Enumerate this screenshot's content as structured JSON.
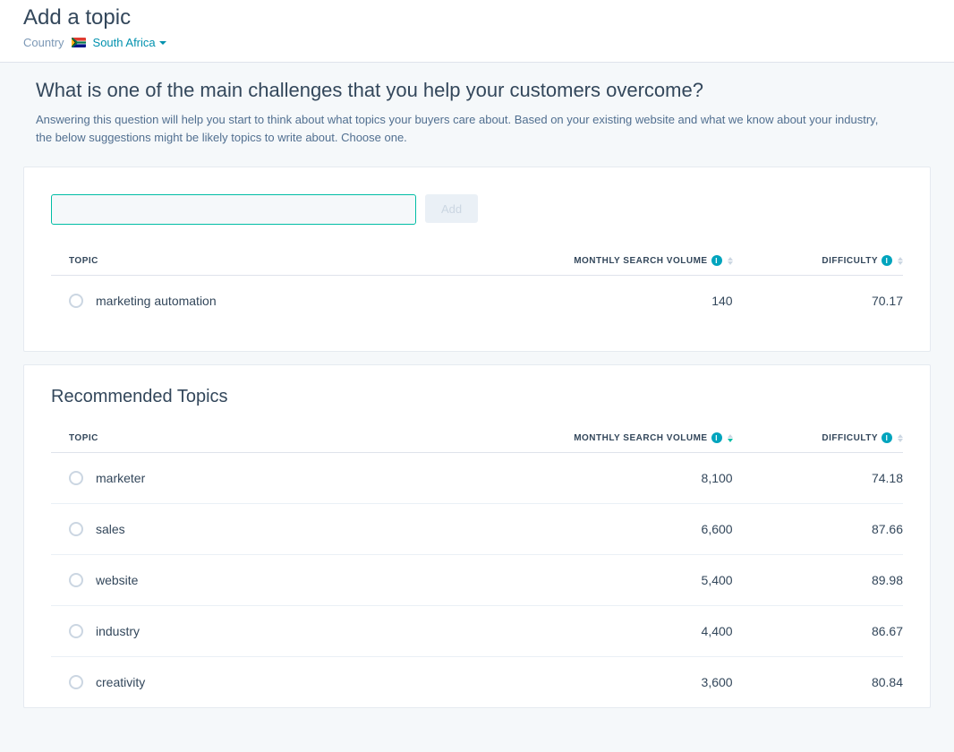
{
  "header": {
    "title": "Add a topic",
    "country_label": "Country",
    "country_value": "South Africa"
  },
  "intro": {
    "heading": "What is one of the main challenges that you help your customers overcome?",
    "text": "Answering this question will help you start to think about what topics your buyers care about. Based on your existing website and what we know about your industry, the below suggestions might be likely topics to write about. Choose one."
  },
  "add_card": {
    "add_label": "Add",
    "input_value": "",
    "columns": {
      "topic": "TOPIC",
      "volume": "MONTHLY SEARCH VOLUME",
      "difficulty": "DIFFICULTY"
    },
    "rows": [
      {
        "topic": "marketing automation",
        "volume": "140",
        "difficulty": "70.17"
      }
    ]
  },
  "recommended": {
    "title": "Recommended Topics",
    "columns": {
      "topic": "TOPIC",
      "volume": "MONTHLY SEARCH VOLUME",
      "difficulty": "DIFFICULTY"
    },
    "rows": [
      {
        "topic": "marketer",
        "volume": "8,100",
        "difficulty": "74.18"
      },
      {
        "topic": "sales",
        "volume": "6,600",
        "difficulty": "87.66"
      },
      {
        "topic": "website",
        "volume": "5,400",
        "difficulty": "89.98"
      },
      {
        "topic": "industry",
        "volume": "4,400",
        "difficulty": "86.67"
      },
      {
        "topic": "creativity",
        "volume": "3,600",
        "difficulty": "80.84"
      }
    ]
  }
}
